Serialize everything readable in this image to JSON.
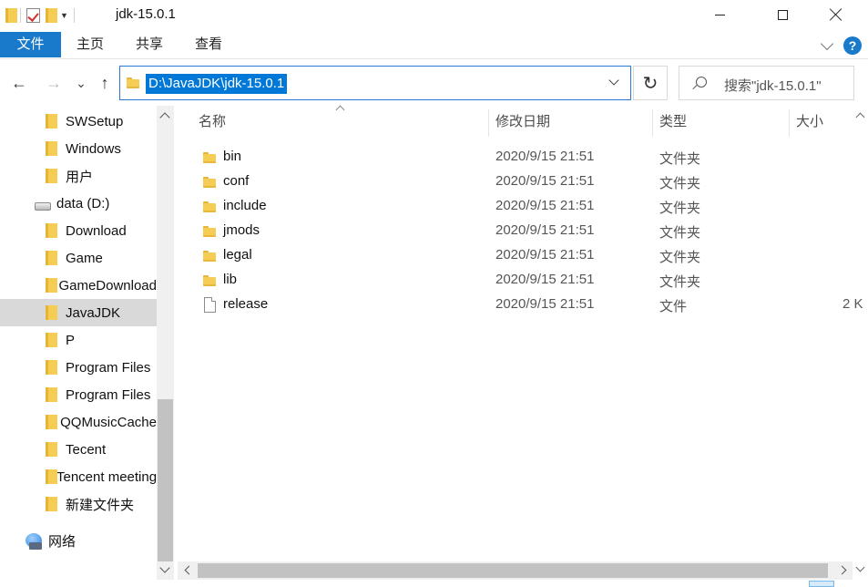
{
  "window": {
    "title": "jdk-15.0.1",
    "minimize_icon": "minimize-icon",
    "maximize_icon": "maximize-icon",
    "close_icon": "close-icon"
  },
  "ribbon": {
    "tabs": [
      {
        "label": "文件"
      },
      {
        "label": "主页"
      },
      {
        "label": "共享"
      },
      {
        "label": "查看"
      }
    ],
    "help_label": "?"
  },
  "address_bar": {
    "path": "D:\\JavaJDK\\jdk-15.0.1",
    "back_icon": "←",
    "forward_icon": "→",
    "recent_icon": "⌄",
    "up_icon": "↑",
    "refresh_icon": "↻"
  },
  "search": {
    "placeholder": "搜索\"jdk-15.0.1\""
  },
  "sidebar": {
    "items": [
      {
        "label": "SWSetup",
        "icon": "folder"
      },
      {
        "label": "Windows",
        "icon": "folder"
      },
      {
        "label": "用户",
        "icon": "folder"
      },
      {
        "label": "data (D:)",
        "icon": "drive"
      },
      {
        "label": "Download",
        "icon": "folder"
      },
      {
        "label": "Game",
        "icon": "folder"
      },
      {
        "label": "GameDownload",
        "icon": "folder"
      },
      {
        "label": "JavaJDK",
        "icon": "folder",
        "selected": true
      },
      {
        "label": "P",
        "icon": "folder"
      },
      {
        "label": "Program Files",
        "icon": "folder"
      },
      {
        "label": "Program Files",
        "icon": "folder"
      },
      {
        "label": "QQMusicCache",
        "icon": "folder"
      },
      {
        "label": "Tecent",
        "icon": "folder"
      },
      {
        "label": "Tencent meeting",
        "icon": "folder"
      },
      {
        "label": "新建文件夹",
        "icon": "folder"
      },
      {
        "label": "网络",
        "icon": "network"
      }
    ]
  },
  "file_list": {
    "columns": {
      "name": "名称",
      "date": "修改日期",
      "type": "类型",
      "size": "大小"
    },
    "rows": [
      {
        "name": "bin",
        "date": "2020/9/15 21:51",
        "type": "文件夹",
        "size": "",
        "icon": "folder"
      },
      {
        "name": "conf",
        "date": "2020/9/15 21:51",
        "type": "文件夹",
        "size": "",
        "icon": "folder"
      },
      {
        "name": "include",
        "date": "2020/9/15 21:51",
        "type": "文件夹",
        "size": "",
        "icon": "folder"
      },
      {
        "name": "jmods",
        "date": "2020/9/15 21:51",
        "type": "文件夹",
        "size": "",
        "icon": "folder"
      },
      {
        "name": "legal",
        "date": "2020/9/15 21:51",
        "type": "文件夹",
        "size": "",
        "icon": "folder"
      },
      {
        "name": "lib",
        "date": "2020/9/15 21:51",
        "type": "文件夹",
        "size": "",
        "icon": "folder"
      },
      {
        "name": "release",
        "date": "2020/9/15 21:51",
        "type": "文件",
        "size": "2 K",
        "icon": "file"
      }
    ]
  },
  "colors": {
    "accent": "#1979ca",
    "selection": "#0078d7",
    "folder": "#f6cd54"
  }
}
